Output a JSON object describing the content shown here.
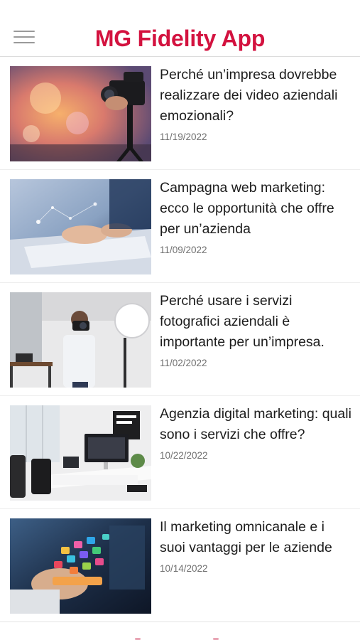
{
  "header": {
    "title": "MG Fidelity App",
    "menu_icon": "hamburger-menu-icon",
    "title_color": "#d3123f"
  },
  "articles": [
    {
      "title": "Perché un’impresa dovrebbe realizzare dei video aziendali emozionali?",
      "date": "11/19/2022",
      "image": "video-camera-photo"
    },
    {
      "title": "Campagna web marketing: ecco le opportunità che offre per un’azienda",
      "date": "11/09/2022",
      "image": "laptop-typing-photo"
    },
    {
      "title": "Perché usare i servizi fotografici aziendali è importante per un’impresa.",
      "date": "11/02/2022",
      "image": "photographer-studio-photo"
    },
    {
      "title": "Agenzia digital marketing: quali sono i servizi che offre?",
      "date": "10/22/2022",
      "image": "office-desk-photo"
    },
    {
      "title": "Il marketing omnicanale e i suoi vantaggi per le aziende",
      "date": "10/14/2022",
      "image": "smartphone-apps-photo"
    }
  ]
}
